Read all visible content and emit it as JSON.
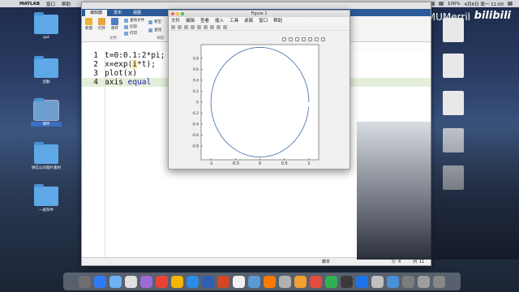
{
  "menubar": {
    "app": "MATLAB",
    "items": [
      "窗口",
      "帮助"
    ],
    "clock": "4月6日 周一 11:00",
    "battery": "100%"
  },
  "watermark": {
    "user": "XMUMerril",
    "site": "bilibili"
  },
  "desktop": {
    "left_icons": [
      "ppt",
      "出勤",
      "课件",
      "微信公众图片素材",
      "一般杂件"
    ]
  },
  "matlab": {
    "tabs": [
      "编辑器",
      "发布",
      "视图"
    ],
    "ribbon": {
      "new": "新建",
      "open": "打开",
      "save": "保存",
      "find_file": "查找文件",
      "compare": "比较",
      "print": "打印",
      "goto": "转至",
      "find": "查找",
      "nav_group": "导航",
      "file_group": "文件"
    },
    "code_lines": [
      {
        "no": "1",
        "parts": [
          {
            "t": "t=0:0.1:2*pi;",
            "c": ""
          }
        ]
      },
      {
        "no": "2",
        "parts": [
          {
            "t": "x=exp(",
            "c": ""
          },
          {
            "t": "i",
            "c": "hl"
          },
          {
            "t": "*t);",
            "c": ""
          }
        ]
      },
      {
        "no": "3",
        "parts": [
          {
            "t": "plot(x)",
            "c": ""
          }
        ]
      },
      {
        "no": "4",
        "parts": [
          {
            "t": "axis ",
            "c": ""
          },
          {
            "t": "equal",
            "c": "kw"
          }
        ]
      }
    ],
    "status": {
      "mode": "脚本",
      "row_label": "行",
      "row": "4",
      "col_label": "列",
      "col": "11"
    }
  },
  "figure": {
    "title": "Figure 1",
    "menu": [
      "文件",
      "编辑",
      "查看",
      "插入",
      "工具",
      "桌面",
      "窗口",
      "帮助"
    ],
    "chart_data": {
      "type": "line",
      "series": [
        {
          "equation": "x = exp(i*t), t = 0:0.1:2*pi",
          "points": "unit circle with gap near angle 0"
        }
      ],
      "xlim": [
        -1.2,
        1.2
      ],
      "ylim": [
        -1,
        1
      ],
      "xticks": [
        "-1",
        "-0.5",
        "0",
        "0.5",
        "1"
      ],
      "yticks": [
        "-0.8",
        "-0.6",
        "-0.4",
        "-0.2",
        "0",
        "0.2",
        "0.4",
        "0.6",
        "0.8"
      ],
      "line_color": "#3d6aa5"
    }
  }
}
